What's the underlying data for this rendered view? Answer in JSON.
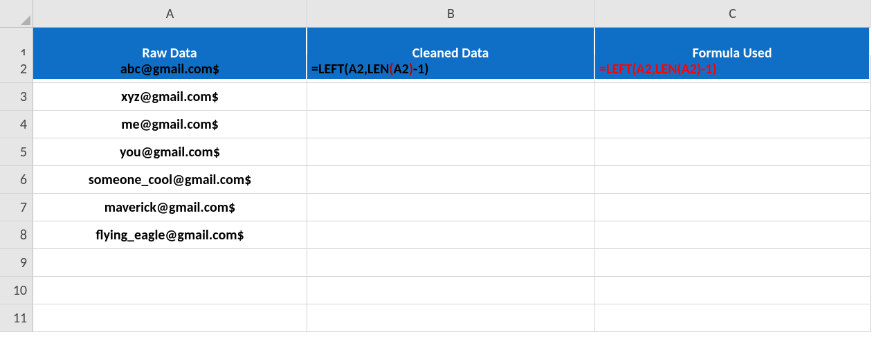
{
  "columns": [
    "A",
    "B",
    "C"
  ],
  "rowNumbers": [
    "1",
    "2",
    "3",
    "4",
    "5",
    "6",
    "7",
    "8",
    "9",
    "10",
    "11"
  ],
  "headers": {
    "a": "Raw Data",
    "b": "Cleaned Data",
    "c": "Formula Used"
  },
  "rawData": [
    "abc@gmail.com$",
    "xyz@gmail.com$",
    "me@gmail.com$",
    "you@gmail.com$",
    "someone_cool@gmail.com$",
    "maverick@gmail.com$",
    "flying_eagle@gmail.com$"
  ],
  "b2": {
    "pre": "=LEFT(A2,LEN",
    "paren": "(",
    "mid": "A2",
    "paren2": ")",
    "post": "-1)"
  },
  "c2": "=LEFT(A2,LEN(A2)-1)"
}
